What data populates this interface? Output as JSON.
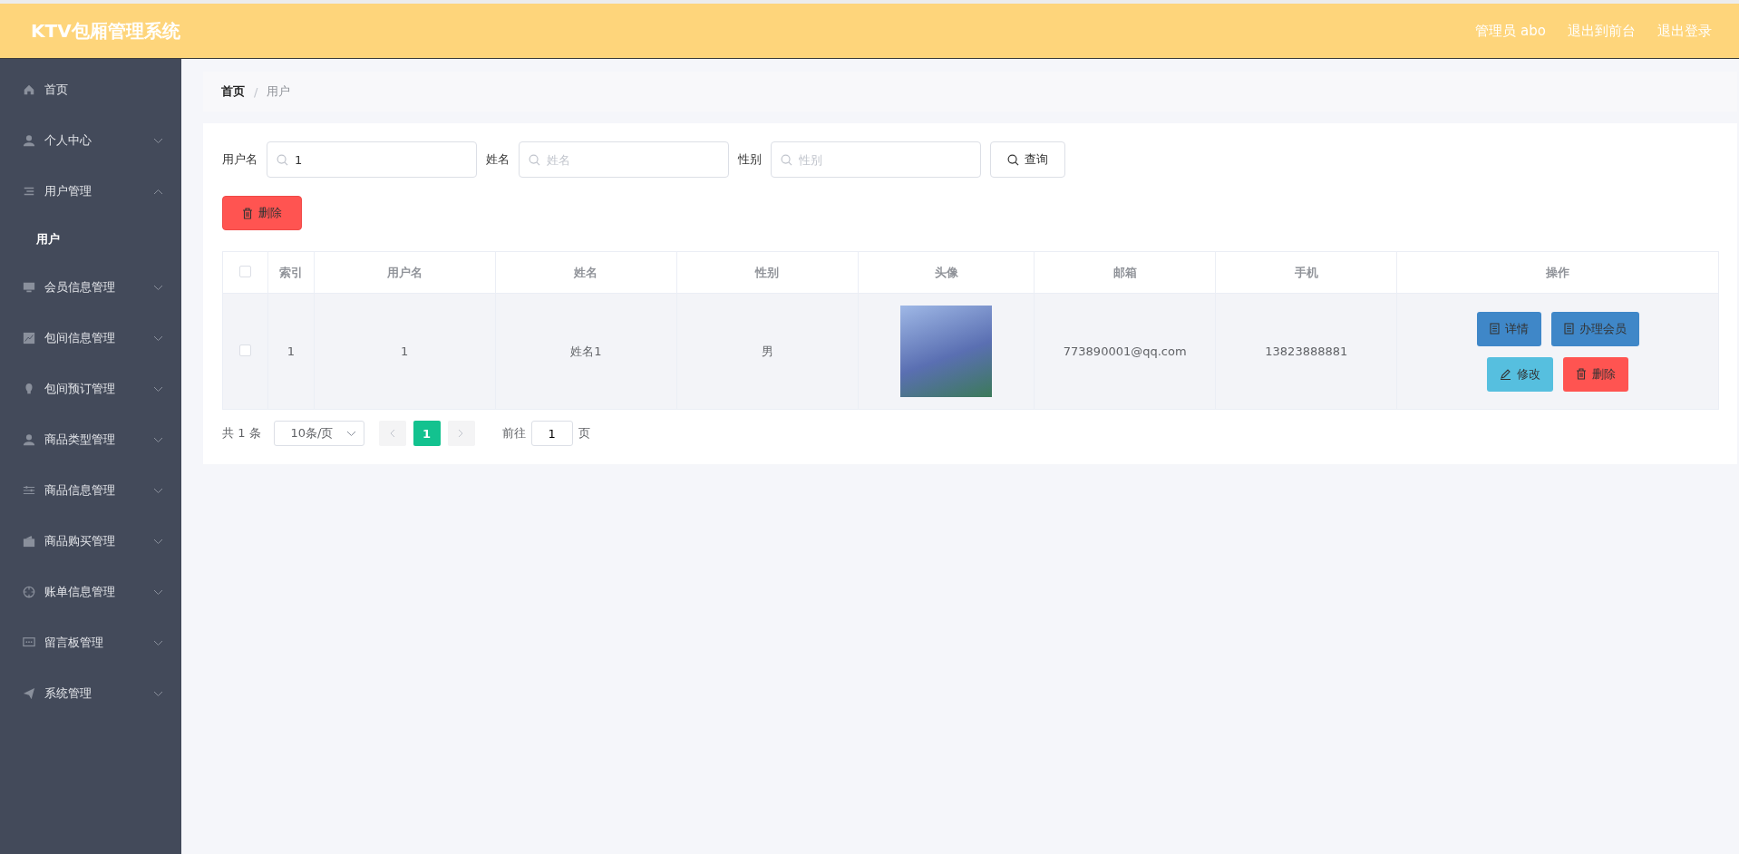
{
  "header": {
    "title": "KTV包厢管理系统",
    "links": [
      "管理员 abo",
      "退出到前台",
      "退出登录"
    ]
  },
  "sidebar": {
    "items": [
      {
        "label": "首页",
        "kind": "link"
      },
      {
        "label": "个人中心",
        "kind": "menu",
        "expanded": false
      },
      {
        "label": "用户管理",
        "kind": "menu",
        "expanded": true,
        "children": [
          {
            "label": "用户",
            "selected": true
          }
        ]
      },
      {
        "label": "会员信息管理",
        "kind": "menu",
        "expanded": false
      },
      {
        "label": "包间信息管理",
        "kind": "menu",
        "expanded": false
      },
      {
        "label": "包间预订管理",
        "kind": "menu",
        "expanded": false
      },
      {
        "label": "商品类型管理",
        "kind": "menu",
        "expanded": false
      },
      {
        "label": "商品信息管理",
        "kind": "menu",
        "expanded": false
      },
      {
        "label": "商品购买管理",
        "kind": "menu",
        "expanded": false
      },
      {
        "label": "账单信息管理",
        "kind": "menu",
        "expanded": false
      },
      {
        "label": "留言板管理",
        "kind": "menu",
        "expanded": false
      },
      {
        "label": "系统管理",
        "kind": "menu",
        "expanded": false
      }
    ]
  },
  "breadcrumb": [
    "首页",
    "/",
    "用户"
  ],
  "search": {
    "fields": [
      {
        "label": "用户名",
        "value": "1"
      },
      {
        "label": "姓名",
        "placeholder": "姓名"
      },
      {
        "label": "性别",
        "placeholder": "性别"
      }
    ],
    "button": "查询"
  },
  "delete_button": "删除",
  "table": {
    "header_checked": false,
    "columns": [
      "索引",
      "用户名",
      "姓名",
      "性别",
      "头像",
      "邮箱",
      "手机",
      "操作"
    ],
    "rows": [
      {
        "checked": false,
        "cells": [
          "1",
          "1",
          "姓名1",
          "男",
          "",
          "773890001@qq.com",
          "13823888881"
        ],
        "actions": [
          {
            "label": "详情",
            "kind": "detail"
          },
          {
            "label": "办理会员",
            "kind": "detail"
          },
          {
            "label": "修改",
            "kind": "edit"
          },
          {
            "label": "删除",
            "kind": "delete"
          }
        ]
      }
    ]
  },
  "pagination": {
    "total": "共 1 条",
    "page_size": "10条/页",
    "pages": [
      {
        "label": "1",
        "selected": true
      }
    ],
    "goto_label": "前往",
    "goto_value": "1",
    "goto_suffix": "页"
  }
}
